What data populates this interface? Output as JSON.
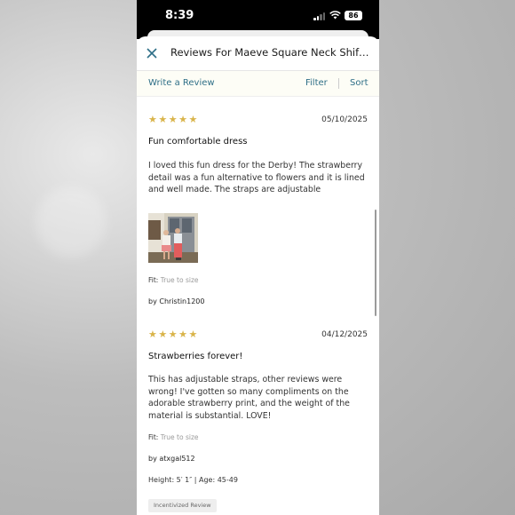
{
  "status_bar": {
    "time": "8:39",
    "battery": "86"
  },
  "header": {
    "title": "Reviews For Maeve Square Neck Shift..."
  },
  "actions": {
    "write": "Write a Review",
    "filter": "Filter",
    "sort": "Sort"
  },
  "reviews": [
    {
      "stars": "★★★★★",
      "rating": 5,
      "date": "05/10/2025",
      "title": "Fun comfortable dress",
      "body": "I loved this fun dress for the Derby! The strawberry detail was a fun alternative to flowers and it is lined and well made. The straps are adjustable",
      "fit_label": "Fit:",
      "fit_value": "True to size",
      "author": "by Christin1200"
    },
    {
      "stars": "★★★★★",
      "rating": 5,
      "date": "04/12/2025",
      "title": "Strawberries forever!",
      "body": "This has adjustable straps, other reviews were wrong! I've gotten so many compliments on the adorable strawberry print, and the weight of the material is substantial. LOVE!",
      "fit_label": "Fit:",
      "fit_value": "True to size",
      "author": "by atxgal512",
      "meta": "Height: 5′ 1″   |   Age: 45-49",
      "badge": "Incentivized Review"
    }
  ],
  "colors": {
    "accent": "#2f6f87",
    "star": "#d9b44a",
    "action_bar_bg": "#fdfdf6"
  }
}
